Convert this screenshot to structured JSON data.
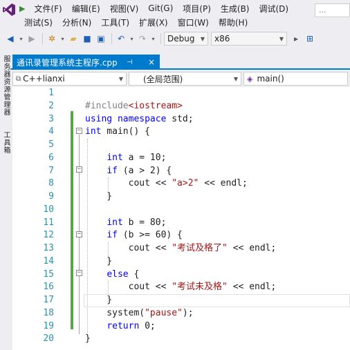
{
  "menu": {
    "row1": [
      "文件(F)",
      "编辑(E)",
      "视图(V)",
      "Git(G)",
      "项目(P)",
      "生成(B)",
      "调试(D)"
    ],
    "row2": [
      "测试(S)",
      "分析(N)",
      "工具(T)",
      "扩展(X)",
      "窗口(W)",
      "帮助(H)"
    ],
    "search_placeholder": "..."
  },
  "toolbar": {
    "config": "Debug",
    "platform": "x86"
  },
  "side_panels": [
    "服务器资源管理器",
    "工具箱"
  ],
  "tab": {
    "label": "通讯录管理系统主程序.cpp",
    "pin": "⊣",
    "close": "×"
  },
  "navbar": {
    "project": "C++lianxi",
    "scope": "(全局范围)",
    "member": "main()"
  },
  "code_lines": [
    {
      "n": "1",
      "t": ""
    },
    {
      "n": "2",
      "t": "#include<iostream>"
    },
    {
      "n": "3",
      "t": "using namespace std;"
    },
    {
      "n": "4",
      "t": "int main() {"
    },
    {
      "n": "5",
      "t": ""
    },
    {
      "n": "6",
      "t": "    int a = 10;"
    },
    {
      "n": "7",
      "t": "    if (a > 2) {"
    },
    {
      "n": "8",
      "t": "        cout << \"a>2\" << endl;"
    },
    {
      "n": "9",
      "t": "    }"
    },
    {
      "n": "10",
      "t": ""
    },
    {
      "n": "11",
      "t": "    int b = 80;"
    },
    {
      "n": "12",
      "t": "    if (b >= 60) {"
    },
    {
      "n": "13",
      "t": "        cout << \"考试及格了\" << endl;"
    },
    {
      "n": "14",
      "t": "    }"
    },
    {
      "n": "15",
      "t": "    else {"
    },
    {
      "n": "16",
      "t": "        cout << \"考试未及格\" << endl;"
    },
    {
      "n": "17",
      "t": "    }"
    },
    {
      "n": "18",
      "t": "    system(\"pause\");"
    },
    {
      "n": "19",
      "t": "    return 0;"
    },
    {
      "n": "20",
      "t": "}"
    }
  ],
  "colors": {
    "accent": "#007acc",
    "keyword": "#0000ff",
    "string": "#a31515",
    "line_number": "#2b91af",
    "change_bar": "#57a64a"
  }
}
